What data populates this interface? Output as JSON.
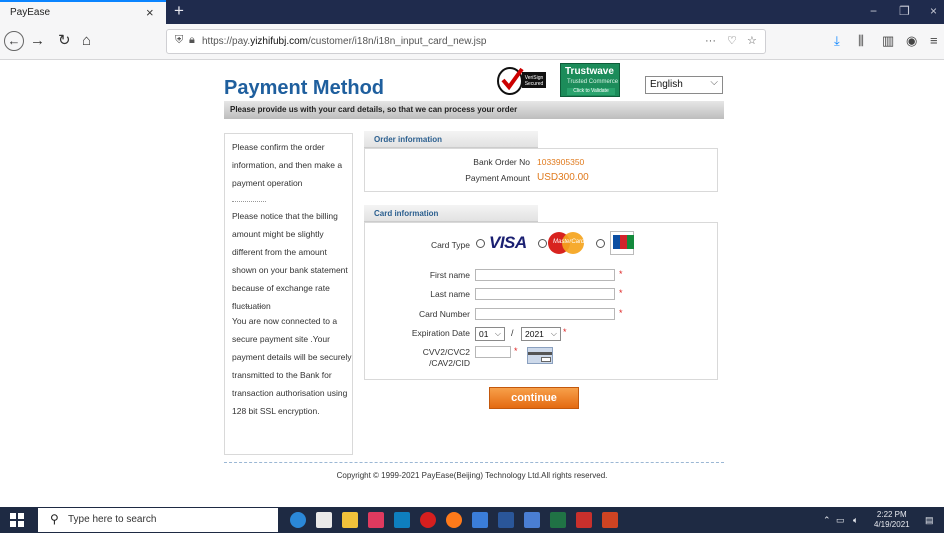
{
  "browser": {
    "tab_title": "PayEase",
    "tab_close": "×",
    "new_tab": "+",
    "win_min": "−",
    "win_max": "❐",
    "win_close": "×",
    "url_prefix": "https://pay.",
    "url_domain": "yizhifubj.com",
    "url_path": "/customer/i18n/i18n_input_card_new.jsp",
    "url_more": "···",
    "icons": [
      "back-icon",
      "forward-icon",
      "reload-icon",
      "home-icon",
      "shield-icon",
      "lock-icon",
      "pocket-icon",
      "bookmark-star-icon",
      "download-icon",
      "library-icon",
      "sidebar-icon",
      "account-icon",
      "menu-icon"
    ]
  },
  "header": {
    "title": "Payment Method",
    "badge_verisign_line1": "VeriSign",
    "badge_verisign_line2": "Secured",
    "badge_trustwave_line1": "Trustwave",
    "badge_trustwave_line2": "Trusted Commerce",
    "badge_trustwave_line3": "Click to Validate",
    "language": "English",
    "instruction": "Please provide us with your card details, so that we can process your order"
  },
  "left_panel": {
    "para1": "Please confirm the order information, and then make a payment operation",
    "para2": "Please notice that the billing amount might be slightly different from the amount shown on your bank statement because of exchange rate fluctuation",
    "para3": "You are now connected to a secure payment site .Your payment details will be securely transmitted to the Bank for transaction authorisation using 128 bit SSL encryption."
  },
  "order": {
    "heading": "Order information",
    "bank_order_label": "Bank Order No",
    "bank_order_value": "1033905350",
    "amount_label": "Payment Amount",
    "amount_value": "USD300.00"
  },
  "card": {
    "heading": "Card information",
    "type_label": "Card Type",
    "visa_text": "VISA",
    "mastercard_text": "MasterCard",
    "first_name_label": "First name",
    "last_name_label": "Last name",
    "card_number_label": "Card Number",
    "expiration_label": "Expiration Date",
    "exp_month": "01",
    "exp_year": "2021",
    "exp_sep": "/",
    "cvv_label_line1": "CVV2/CVC2",
    "cvv_label_line2": "/CAV2/CID",
    "required_mark": "*"
  },
  "continue_label": "continue",
  "footer": {
    "copyright": "Copyright © 1999-2021 PayEase(Beijing) Technology Ltd.All rights reserved."
  },
  "taskbar": {
    "search_placeholder": "Type here to search",
    "time": "2:22 PM",
    "date": "4/19/2021"
  }
}
